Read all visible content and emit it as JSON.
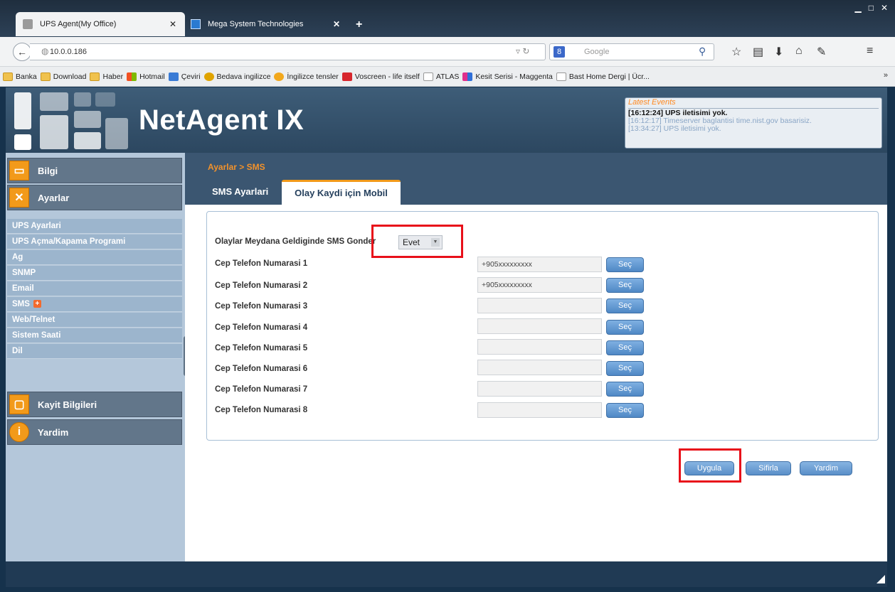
{
  "browser": {
    "tabs": [
      {
        "label": "UPS Agent(My Office)",
        "active": true
      },
      {
        "label": "Mega System Technologies",
        "active": false
      }
    ],
    "new_tab": "+",
    "url": "10.0.0.186",
    "search_placeholder": "Google",
    "bookmarks": [
      {
        "label": "Banka",
        "icon": "folder-icon"
      },
      {
        "label": "Download",
        "icon": "folder-icon"
      },
      {
        "label": "Haber",
        "icon": "folder-icon"
      },
      {
        "label": "Hotmail",
        "icon": "windows-icon"
      },
      {
        "label": "Çeviri",
        "icon": "translate-icon"
      },
      {
        "label": "Bedava ingilizce",
        "icon": "people-icon"
      },
      {
        "label": "İngilizce tensler",
        "icon": "globe-icon"
      },
      {
        "label": "Voscreen - life itself",
        "icon": "play-icon"
      },
      {
        "label": "ATLAS",
        "icon": "page-icon"
      },
      {
        "label": "Kesit Serisi - Maggenta",
        "icon": "squares-icon"
      },
      {
        "label": "Bast Home Dergi | Ücr...",
        "icon": "page-icon"
      }
    ],
    "bookmarks_more": "»"
  },
  "app": {
    "title": "NetAgent IX",
    "events": {
      "title": "Latest Events",
      "items": [
        "[16:12:24] UPS iletisimi yok.",
        "[16:12:17] Timeserver baglantisi time.nist.gov basarisiz.",
        "[13:34:27] UPS iletisimi yok."
      ]
    }
  },
  "sidebar": {
    "sections": {
      "bilgi": "Bilgi",
      "ayarlar": "Ayarlar",
      "kayit": "Kayit Bilgileri",
      "yardim": "Yardim"
    },
    "items": [
      "UPS Ayarlari",
      "UPS Açma/Kapama Programi",
      "Ag",
      "SNMP",
      "Email",
      "SMS",
      "Web/Telnet",
      "Sistem Saati",
      "Dil"
    ]
  },
  "main": {
    "breadcrumb": "Ayarlar > SMS",
    "tabs": [
      "SMS Ayarlari",
      "Olay Kaydi için Mobil"
    ],
    "send_sms_label": "Olaylar Meydana Geldiginde SMS Gonder",
    "send_sms_value": "Evet",
    "phones": [
      {
        "label": "Cep Telefon Numarasi 1",
        "value": "+905xxxxxxxxx"
      },
      {
        "label": "Cep Telefon Numarasi 2",
        "value": "+905xxxxxxxxx"
      },
      {
        "label": "Cep Telefon Numarasi 3",
        "value": ""
      },
      {
        "label": "Cep Telefon Numarasi 4",
        "value": ""
      },
      {
        "label": "Cep Telefon Numarasi 5",
        "value": ""
      },
      {
        "label": "Cep Telefon Numarasi 6",
        "value": ""
      },
      {
        "label": "Cep Telefon Numarasi 7",
        "value": ""
      },
      {
        "label": "Cep Telefon Numarasi 8",
        "value": ""
      }
    ],
    "select_button": "Seç",
    "actions": {
      "apply": "Uygula",
      "reset": "Sifirla",
      "help": "Yardim"
    }
  },
  "colors": {
    "accent_orange": "#f29a1a",
    "header_blue": "#2c4760",
    "highlight_red": "#e8101a"
  }
}
